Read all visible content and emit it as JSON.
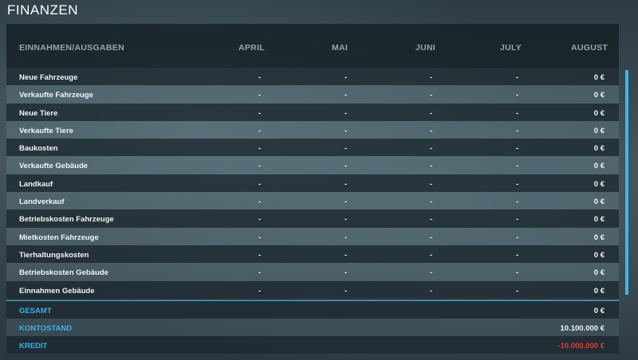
{
  "title": "FINANZEN",
  "header": {
    "label": "EINNAHMEN/AUSGABEN",
    "months": [
      "APRIL",
      "MAI",
      "JUNI",
      "JULY",
      "AUGUST"
    ]
  },
  "rows": [
    {
      "label": "Neue Fahrzeuge",
      "values": [
        "-",
        "-",
        "-",
        "-"
      ],
      "amount": "0 €"
    },
    {
      "label": "Verkaufte Fahrzeuge",
      "values": [
        "-",
        "-",
        "-",
        "-"
      ],
      "amount": "0 €"
    },
    {
      "label": "Neue Tiere",
      "values": [
        "-",
        "-",
        "-",
        "-"
      ],
      "amount": "0 €"
    },
    {
      "label": "Verkaufte Tiere",
      "values": [
        "-",
        "-",
        "-",
        "-"
      ],
      "amount": "0 €"
    },
    {
      "label": "Baukosten",
      "values": [
        "-",
        "-",
        "-",
        "-"
      ],
      "amount": "0 €"
    },
    {
      "label": "Verkaufte Gebäude",
      "values": [
        "-",
        "-",
        "-",
        "-"
      ],
      "amount": "0 €"
    },
    {
      "label": "Landkauf",
      "values": [
        "-",
        "-",
        "-",
        "-"
      ],
      "amount": "0 €"
    },
    {
      "label": "Landverkauf",
      "values": [
        "-",
        "-",
        "-",
        "-"
      ],
      "amount": "0 €"
    },
    {
      "label": "Betriebskosten Fahrzeuge",
      "values": [
        "-",
        "-",
        "-",
        "-"
      ],
      "amount": "0 €"
    },
    {
      "label": "Mietkosten Fahrzeuge",
      "values": [
        "-",
        "-",
        "-",
        "-"
      ],
      "amount": "0 €"
    },
    {
      "label": "Tierhaltungskosten",
      "values": [
        "-",
        "-",
        "-",
        "-"
      ],
      "amount": "0 €"
    },
    {
      "label": "Betriebskosten Gebäude",
      "values": [
        "-",
        "-",
        "-",
        "-"
      ],
      "amount": "0 €"
    },
    {
      "label": "Einnahmen Gebäude",
      "values": [
        "-",
        "-",
        "-",
        "-"
      ],
      "amount": "0 €"
    }
  ],
  "totals": {
    "gesamt": {
      "label": "GESAMT",
      "amount": "0 €"
    },
    "kontostand": {
      "label": "KONTOSTAND",
      "amount": "10.100.000 €"
    },
    "kredit": {
      "label": "KREDIT",
      "amount": "-10.000.000 €"
    }
  },
  "colors": {
    "accent": "#3fb6e8",
    "negative": "#e03a3a"
  }
}
